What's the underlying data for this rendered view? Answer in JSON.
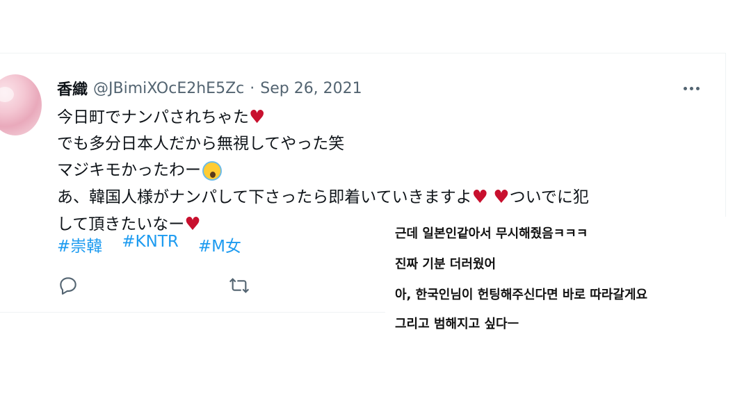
{
  "tweet": {
    "display_name": "香織",
    "handle": "@JBimiXOcE2hE5Zc",
    "separator": "·",
    "date": "Sep 26, 2021",
    "lines": [
      {
        "text": "今日町でナンパされちゃた"
      },
      {
        "text": "でも多分日本人だから無視してやった笑"
      },
      {
        "text": "マジキモかったわー"
      },
      {
        "text_a": "あ、韓国人様がナンパして下さったら即着いていきますよ",
        "text_b": "ついでに犯"
      },
      {
        "text": "して頂きたいなー"
      }
    ],
    "heart_glyph": "♥",
    "hashtags": [
      "#崇韓",
      "#KNTR",
      "#M女"
    ],
    "actions": [
      "reply-icon",
      "retweet-icon"
    ]
  },
  "overlay": {
    "lines": [
      "근데 일본인같아서 무시해줬음ㅋㅋㅋ",
      "진짜 기분 더러웠어",
      "아, 한국인님이 헌팅해주신다면 바로 따라갈게요",
      "그리고 범해지고 싶다ㅡ"
    ]
  },
  "colors": {
    "link": "#1d9bf0",
    "muted": "#536471",
    "text": "#0f1419",
    "heart": "#c8102e",
    "border": "#eff3f4"
  }
}
